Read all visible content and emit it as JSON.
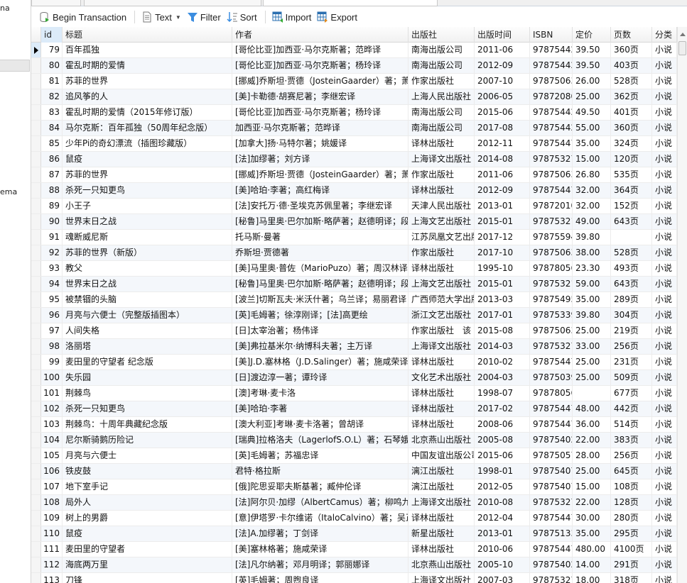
{
  "sidebar": {
    "items": [
      "na",
      "ema"
    ]
  },
  "toolbar": {
    "begin_transaction": "Begin Transaction",
    "text": "Text",
    "filter": "Filter",
    "sort": "Sort",
    "import": "Import",
    "export": "Export"
  },
  "table": {
    "columns": [
      "id",
      "标题",
      "作者",
      "出版社",
      "出版时间",
      "ISBN",
      "定价",
      "页数",
      "分类"
    ],
    "current_row_id": 79,
    "rows": [
      [
        "79",
        "百年孤独",
        "[哥伦比亚]加西亚·马尔克斯著；范晔译",
        "南海出版公司",
        "2011-06",
        "97875442",
        "39.50",
        "360页",
        "小说"
      ],
      [
        "80",
        "霍乱时期的爱情",
        "[哥伦比亚]加西亚·马尔克斯著；杨玲译",
        "南海出版公司",
        "2012-09",
        "97875442",
        "39.50",
        "403页",
        "小说"
      ],
      [
        "81",
        "苏菲的世界",
        "[挪威]乔斯坦·贾德（JosteinGaarder）著；萧",
        "作家出版社",
        "2007-10",
        "97875063",
        "26.00",
        "528页",
        "小说"
      ],
      [
        "82",
        "追风筝的人",
        "[美]卡勒德·胡赛尼著；李继宏译",
        "上海人民出版社",
        "2006-05",
        "97872080",
        "25.00",
        "362页",
        "小说"
      ],
      [
        "83",
        "霍乱时期的爱情（2015年修订版）",
        "[哥伦比亚]加西亚·马尔克斯著；杨玲译",
        "南海出版公司",
        "2015-06",
        "97875442",
        "49.50",
        "401页",
        "小说"
      ],
      [
        "84",
        "马尔克斯：百年孤独（50周年纪念版）",
        "加西亚·马尔克斯著；范晔译",
        "南海出版公司",
        "2017-08",
        "97875442",
        "55.00",
        "360页",
        "小说"
      ],
      [
        "85",
        "少年Pi的奇幻漂流（插图珍藏版）",
        "[加拿大]扬·马特尔著；姚媛译",
        "译林出版社",
        "2012-11",
        "97875447",
        "35.00",
        "324页",
        "小说"
      ],
      [
        "86",
        "鼠疫",
        "[法]加缪著；刘方译",
        "上海译文出版社",
        "2014-08",
        "97875327",
        "15.00",
        "120页",
        "小说"
      ],
      [
        "87",
        "苏菲的世界",
        "[挪威]乔斯坦·贾德（JosteinGaarder）著；萧",
        "作家出版社",
        "2011-06",
        "97875063",
        "26.80",
        "535页",
        "小说"
      ],
      [
        "88",
        "杀死一只知更鸟",
        "[美]哈珀·李著；高红梅译",
        "译林出版社",
        "2012-09",
        "97875447",
        "32.00",
        "364页",
        "小说"
      ],
      [
        "89",
        "小王子",
        "[法]安托万·德·圣埃克苏佩里著；李继宏译",
        "天津人民出版社",
        "2013-01",
        "97872010",
        "32.00",
        "152页",
        "小说"
      ],
      [
        "90",
        "世界末日之战",
        "[秘鲁]马里奥·巴尔加斯·略萨著；赵德明译；段",
        "上海文艺出版社",
        "2015-01",
        "97875321",
        "49.00",
        "643页",
        "小说"
      ],
      [
        "91",
        "魂断威尼斯",
        "托马斯·曼著",
        "江苏凤凰文艺出版",
        "2017-12",
        "97875594",
        "39.80",
        "",
        "小说"
      ],
      [
        "92",
        "苏菲的世界（新版）",
        "乔斯坦·贾德著",
        "作家出版社",
        "2017-10",
        "97875063",
        "38.00",
        "528页",
        "小说"
      ],
      [
        "93",
        "教父",
        "[美]马里奥·普佐（MarioPuzo）著；周汉林译",
        "译林出版社",
        "1995-10",
        "97878056",
        "23.30",
        "493页",
        "小说"
      ],
      [
        "94",
        "世界末日之战",
        "[秘鲁]马里奥·巴尔加斯·略萨著；赵德明译；段",
        "上海文艺出版社",
        "2015-01",
        "97875321",
        "59.00",
        "643页",
        "小说"
      ],
      [
        "95",
        "被禁锢的头脑",
        "[波兰]切斯瓦夫·米沃什著；乌兰译；易丽君译",
        "广西师范大学出版",
        "2013-03",
        "97875495",
        "35.00",
        "289页",
        "小说"
      ],
      [
        "96",
        "月亮与六便士（完整版插图本）",
        "[英]毛姆著；徐淳刚译；[法]高更绘",
        "浙江文艺出版社",
        "2017-01",
        "97875339",
        "39.80",
        "304页",
        "小说"
      ],
      [
        "97",
        "人间失格",
        "[日]太宰治著；杨伟译",
        "作家出版社　该",
        "2015-08",
        "97875063",
        "25.00",
        "219页",
        "小说"
      ],
      [
        "98",
        "洛丽塔",
        "[美]弗拉基米尔·纳博科夫著；主万译",
        "上海译文出版社",
        "2014-03",
        "97875327",
        "33.00",
        "256页",
        "小说"
      ],
      [
        "99",
        "麦田里的守望者 纪念版",
        "[美]J.D.塞林格（J.D.Salinger）著；施咸荣译",
        "译林出版社",
        "2010-02",
        "97875447",
        "25.00",
        "231页",
        "小说"
      ],
      [
        "100",
        "失乐园",
        "[日]渡边淳一著；谭玲译",
        "文化艺术出版社",
        "2004-03",
        "97875039",
        "25.00",
        "509页",
        "小说"
      ],
      [
        "101",
        "荆棘鸟",
        "[澳]考琳·麦卡洛",
        "译林出版社",
        "1998-07",
        "97878056",
        "",
        "677页",
        "小说"
      ],
      [
        "102",
        "杀死一只知更鸟",
        "[美]哈珀·李著",
        "译林出版社",
        "2017-02",
        "97875447",
        "48.00",
        "442页",
        "小说"
      ],
      [
        "103",
        "荆棘鸟：十周年典藏纪念版",
        "[澳大利亚]考琳·麦卡洛著；曾胡译",
        "译林出版社",
        "2008-06",
        "97875447",
        "36.00",
        "514页",
        "小说"
      ],
      [
        "104",
        "尼尔斯骑鹅历险记",
        "[瑞典]拉格洛夫（LagerlofS.O.L）著；石琴娥",
        "北京燕山出版社",
        "2005-08",
        "97875402",
        "22.00",
        "383页",
        "小说"
      ],
      [
        "105",
        "月亮与六便士",
        "[英]毛姆著；苏福忠译",
        "中国友谊出版公司",
        "2015-06",
        "97875057",
        "28.00",
        "256页",
        "小说"
      ],
      [
        "106",
        "铁皮鼓",
        "君特·格拉斯",
        "漓江出版社",
        "1998-01",
        "97875407",
        "25.00",
        "645页",
        "小说"
      ],
      [
        "107",
        "地下室手记",
        "[俄]陀思妥耶夫斯基著；臧仲伦译",
        "漓江出版社",
        "2012-05",
        "97875407",
        "15.00",
        "108页",
        "小说"
      ],
      [
        "108",
        "局外人",
        "[法]阿尔贝·加缪（AlbertCamus）著；柳鸣九",
        "上海译文出版社",
        "2010-08",
        "97875327",
        "22.00",
        "128页",
        "小说"
      ],
      [
        "109",
        "树上的男爵",
        "[意]伊塔罗·卡尔维诺（ItaloCalvino）著；吴正",
        "译林出版社",
        "2012-04",
        "97875447",
        "30.00",
        "280页",
        "小说"
      ],
      [
        "110",
        "鼠疫",
        "[法]A.加缪著；丁剑译",
        "新星出版社",
        "2013-01",
        "97875133",
        "35.00",
        "295页",
        "小说"
      ],
      [
        "111",
        "麦田里的守望者",
        "[美]塞林格著；施咸荣译",
        "译林出版社",
        "2010-06",
        "97875447",
        "480.00",
        "4100页",
        "小说"
      ],
      [
        "112",
        "海底两万里",
        "[法]凡尔纳著；邓月明译；郭丽娜译",
        "北京燕山出版社",
        "2005-10",
        "97875402",
        "14.00",
        "291页",
        "小说"
      ],
      [
        "113",
        "刀锋",
        "[英]毛姆著；周煦良译",
        "上海译文出版社",
        "2007-03",
        "97875327",
        "18.00",
        "318页",
        "小说"
      ]
    ]
  }
}
